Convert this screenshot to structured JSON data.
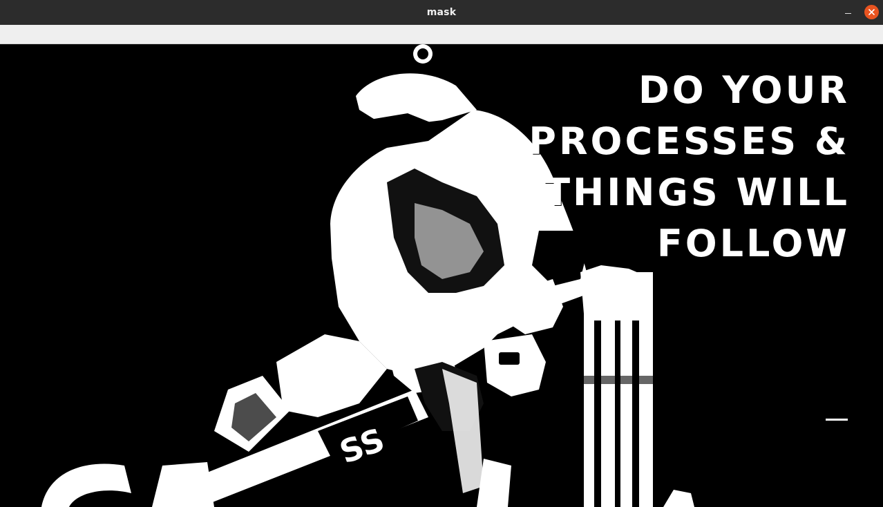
{
  "window": {
    "title": "mask"
  },
  "image": {
    "quote_lines": [
      "DO YOUR",
      "PROCESSES &",
      "THINGS WILL",
      "FOLLOW"
    ],
    "bat_brand": "SS"
  },
  "colors": {
    "titlebar": "#2c2c2c",
    "close_button": "#e95420",
    "toolbar": "#efefef",
    "mask_foreground": "#ffffff",
    "mask_background": "#000000"
  },
  "icons": {
    "minimize": "minimize-icon",
    "close": "close-icon"
  }
}
